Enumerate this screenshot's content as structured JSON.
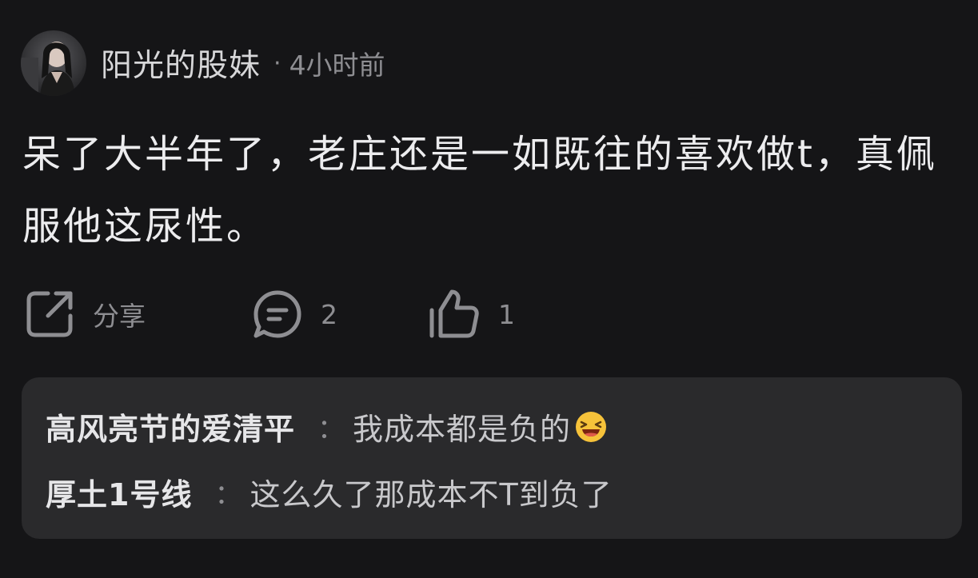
{
  "post": {
    "author": "阳光的股妹",
    "separator": "·",
    "time": "4小时前",
    "body": "呆了大半年了，老庄还是一如既往的喜欢做t，真佩服他这尿性。"
  },
  "actions": {
    "share_label": "分享",
    "comment_count": "2",
    "like_count": "1"
  },
  "replies": [
    {
      "name": "高风亮节的爱清平",
      "separator": "：",
      "text": "我成本都是负的",
      "emoji": "laughing-face-emoji"
    },
    {
      "name": "厚土1号线",
      "separator": "：",
      "text": "这么久了那成本不T到负了"
    }
  ],
  "colors": {
    "background": "#151517",
    "reply_panel": "#2a2a2c",
    "primary_text": "#ececee",
    "secondary_text": "#8e8e92"
  }
}
